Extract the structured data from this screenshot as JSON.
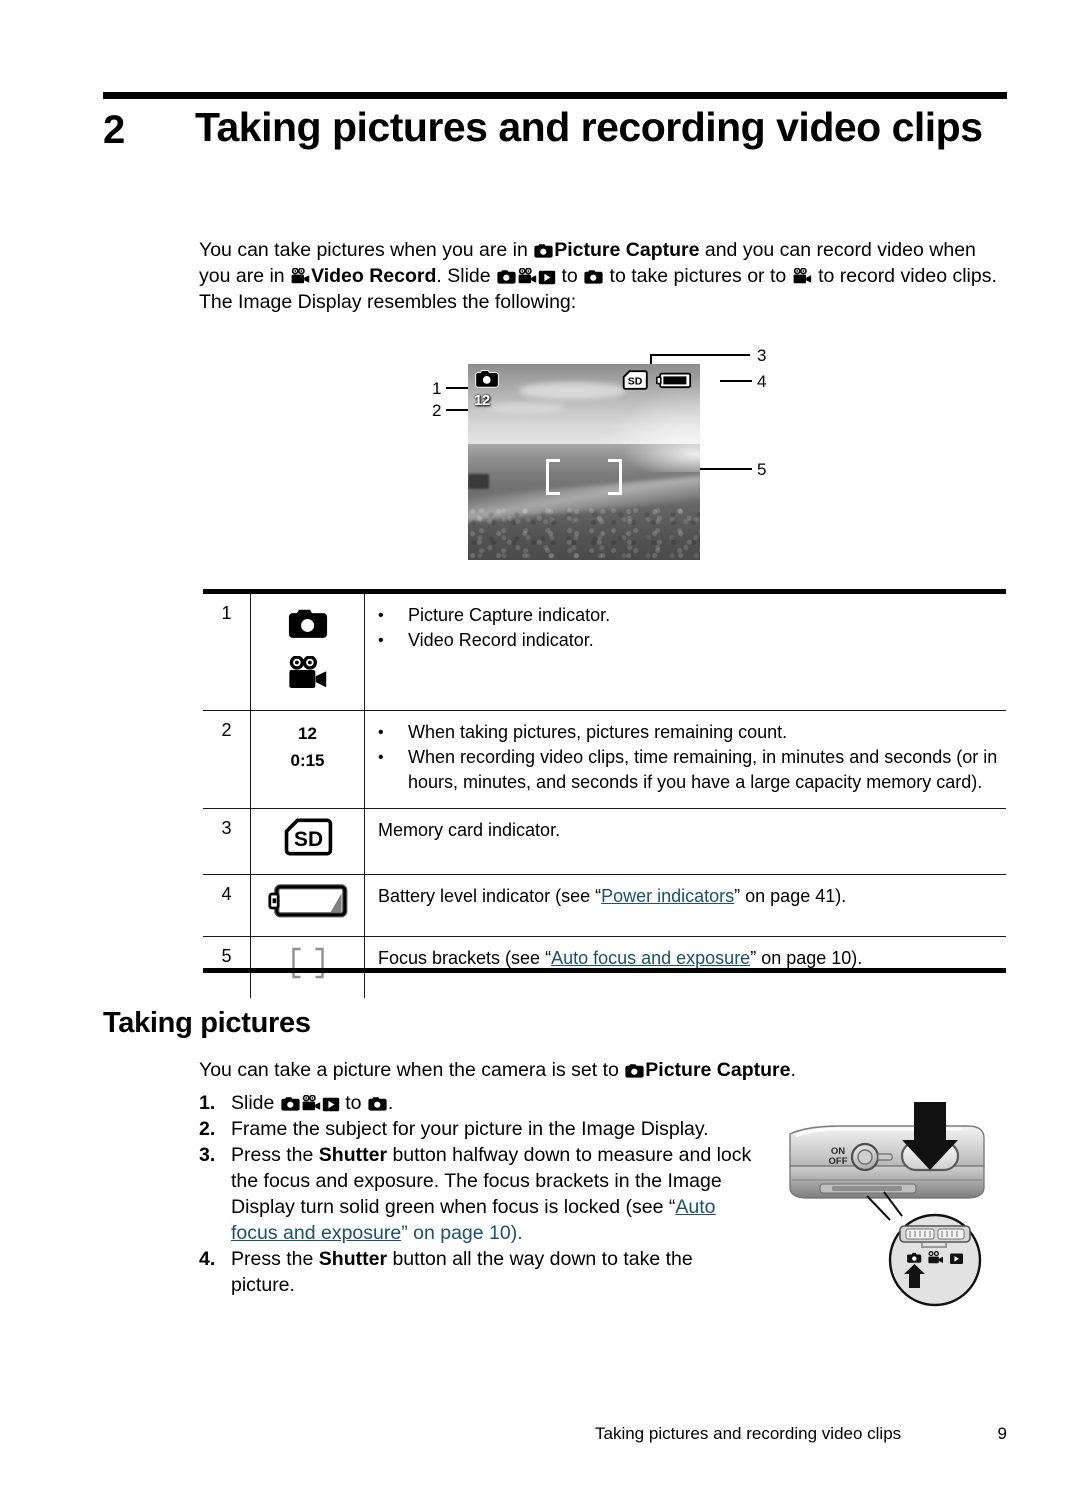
{
  "chapter": {
    "number": "2",
    "title": "Taking pictures and recording video clips"
  },
  "intro": {
    "p1_a": "You can take pictures when you are in ",
    "p1_b": "Picture Capture",
    "p1_c": " and you can record video when you are in ",
    "p1_d": "Video Record",
    "p1_e": ". Slide ",
    "p1_f": " to ",
    "p1_g": " to take pictures or to ",
    "p1_h": " to record video clips. The Image Display resembles the following:"
  },
  "lcd": {
    "count": "12",
    "sd_label": "SD",
    "callouts": [
      "1",
      "2",
      "3",
      "4",
      "5"
    ]
  },
  "table": {
    "rows": [
      {
        "num": "1",
        "icon": "camera-and-video-icons",
        "bullets": [
          "Picture Capture indicator.",
          "Video Record indicator."
        ]
      },
      {
        "num": "2",
        "value1": "12",
        "value2": "0:15",
        "bullets": [
          "When taking pictures, pictures remaining count.",
          "When recording video clips, time remaining, in minutes and seconds (or in hours, minutes, and seconds if you have a large capacity memory card)."
        ]
      },
      {
        "num": "3",
        "icon": "sd-card-icon",
        "icon_label": "SD",
        "text": "Memory card indicator."
      },
      {
        "num": "4",
        "icon": "battery-icon",
        "text_a": "Battery level indicator (see “",
        "link": "Power indicators",
        "text_b": "” on page 41).",
        "page": "41"
      },
      {
        "num": "5",
        "icon": "focus-brackets-icon",
        "text_a": "Focus brackets (see “",
        "link": "Auto focus and exposure",
        "text_b": "” on page 10).",
        "page": "10"
      }
    ]
  },
  "section": {
    "heading": "Taking pictures",
    "intro_a": "You can take a picture when the camera is set to ",
    "intro_b": "Picture Capture",
    "intro_c": ".",
    "steps": [
      {
        "n": "1.",
        "a": "Slide ",
        "b": " to ",
        "c": "."
      },
      {
        "n": "2.",
        "text": "Frame the subject for your picture in the Image Display."
      },
      {
        "n": "3.",
        "a": "Press the ",
        "bold": "Shutter",
        "b": " button halfway down to measure and lock the focus and exposure. The focus brackets in the Image Display turn solid green when focus is locked (see “",
        "link": "Auto focus and exposure",
        "c": "” on page 10)."
      },
      {
        "n": "4.",
        "a": "Press the ",
        "bold": "Shutter",
        "b": " button all the way down to take the picture."
      }
    ]
  },
  "camera_photo": {
    "on_label": "ON",
    "off_label": "OFF"
  },
  "footer": {
    "text": "Taking pictures and recording video clips",
    "page": "9"
  },
  "colors": {
    "link": "#1b4f72",
    "rule": "#000000"
  }
}
